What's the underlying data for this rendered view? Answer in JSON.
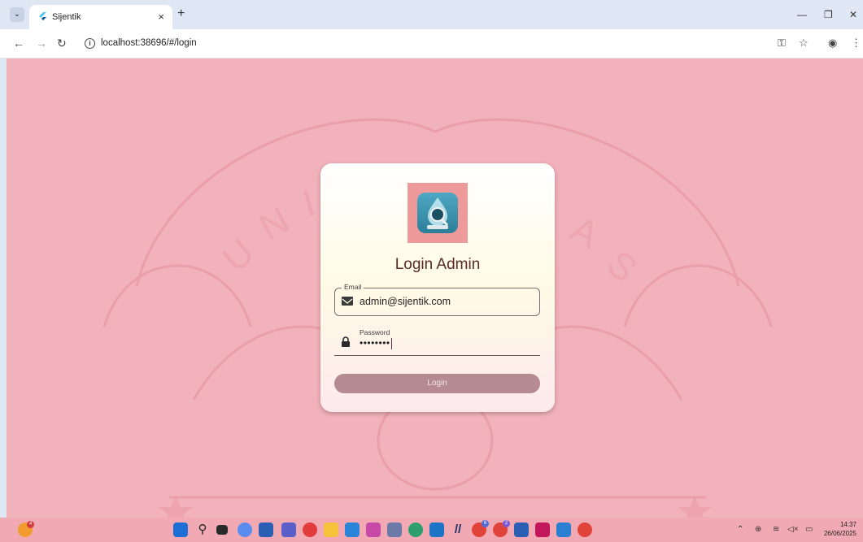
{
  "browser": {
    "tab_title": "Sijentik",
    "tab_menu_icon": "chevron-down-icon",
    "url": "localhost:38696/#/login",
    "colors": {
      "tab_strip": "#dfe6f4",
      "toolbar": "#ffffff"
    }
  },
  "page": {
    "background": "#f2b2bb",
    "card": {
      "title": "Login Admin",
      "email": {
        "label": "Email",
        "value": "admin@sijentik.com"
      },
      "password": {
        "label": "Password",
        "value": "••••••••"
      },
      "login_button": "Login"
    }
  },
  "taskbar": {
    "time": "14:37",
    "date": "26/06/2025",
    "badges": {
      "notif_a": "4",
      "chrome_a": "6",
      "chrome_b": "2"
    },
    "icons": [
      "start-icon",
      "search-icon",
      "task-view-icon",
      "copilot-icon",
      "store-icon",
      "teams-icon",
      "opera-icon",
      "file-explorer-icon",
      "vscode-icon",
      "app-icon",
      "notepad-icon",
      "edge-icon",
      "outlook-icon",
      "slash-app-icon",
      "chrome-icon",
      "chrome-icon",
      "word-icon",
      "app-icon",
      "app-icon",
      "chrome-icon"
    ]
  }
}
